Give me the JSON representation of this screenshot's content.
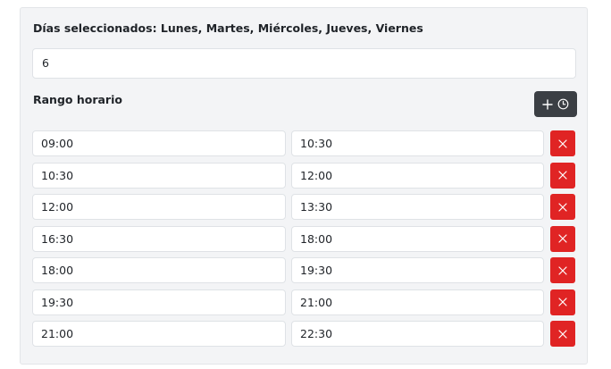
{
  "selected_days": {
    "label": "Días seleccionados: Lunes, Martes, Miércoles, Jueves, Viernes"
  },
  "count_field": {
    "value": "6"
  },
  "time_range": {
    "label": "Rango horario",
    "add_button_icons": [
      "plus-icon",
      "clock-icon"
    ],
    "delete_icon": "close-icon",
    "delete_color": "#e02424",
    "add_button_color": "#3b3f44",
    "rows": [
      {
        "start": "09:00",
        "end": "10:30"
      },
      {
        "start": "10:30",
        "end": "12:00"
      },
      {
        "start": "12:00",
        "end": "13:30"
      },
      {
        "start": "16:30",
        "end": "18:00"
      },
      {
        "start": "18:00",
        "end": "19:30"
      },
      {
        "start": "19:30",
        "end": "21:00"
      },
      {
        "start": "21:00",
        "end": "22:30"
      }
    ]
  }
}
